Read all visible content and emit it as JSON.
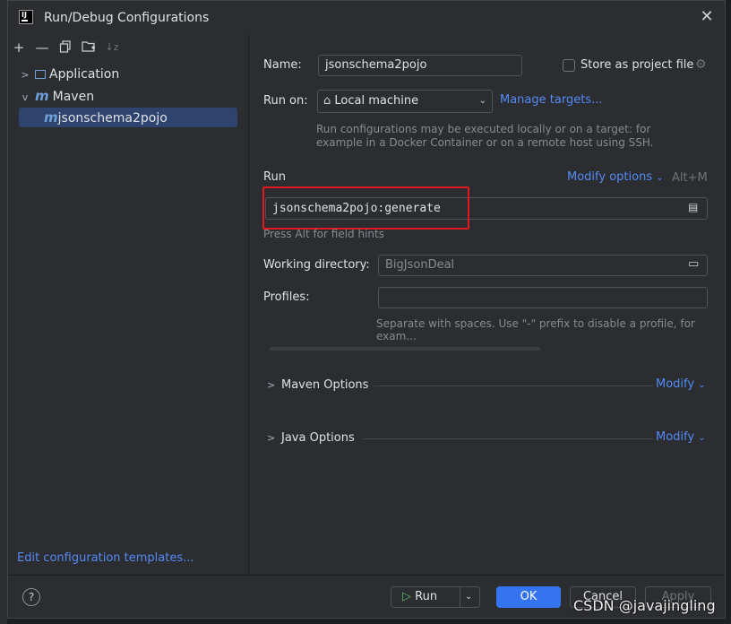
{
  "window": {
    "title": "Run/Debug Configurations"
  },
  "toolbar": {
    "icons": [
      "add-icon",
      "remove-icon",
      "copy-icon",
      "new-folder-icon",
      "sort-icon"
    ]
  },
  "tree": {
    "items": [
      {
        "label": "Application",
        "icon": "application-icon",
        "expanded": false
      },
      {
        "label": "Maven",
        "icon": "maven-icon",
        "expanded": true
      },
      {
        "label": "jsonschema2pojo",
        "icon": "maven-icon",
        "selected": true
      }
    ]
  },
  "edit_templates_label": "Edit configuration templates...",
  "form": {
    "name_label": "Name:",
    "name_value": "jsonschema2pojo",
    "store_label": "Store as project file",
    "run_on_label": "Run on:",
    "run_on_value": "Local machine",
    "manage_targets": "Manage targets...",
    "run_on_hint_1": "Run configurations may be executed locally or on a target: for",
    "run_on_hint_2": "example in a Docker Container or on a remote host using SSH.",
    "run_section": "Run",
    "modify_options": "Modify options",
    "modify_shortcut": "Alt+M",
    "command_value": "jsonschema2pojo:generate",
    "field_hint": "Press Alt for field hints",
    "working_dir_label": "Working directory:",
    "working_dir_value": "BigJsonDeal",
    "profiles_label": "Profiles:",
    "profiles_value": "",
    "profiles_hint": "Separate with spaces. Use \"-\" prefix to disable a profile, for exam...",
    "maven_options": "Maven Options",
    "java_options": "Java Options",
    "modify": "Modify"
  },
  "buttons": {
    "help": "?",
    "run": "Run",
    "ok": "OK",
    "cancel": "Cancel",
    "apply": "Apply"
  },
  "watermark": "CSDN @javajingling",
  "colors": {
    "accent": "#3574f0",
    "link": "#548af7",
    "highlight": "#e0191d",
    "selection": "#2e436e"
  }
}
